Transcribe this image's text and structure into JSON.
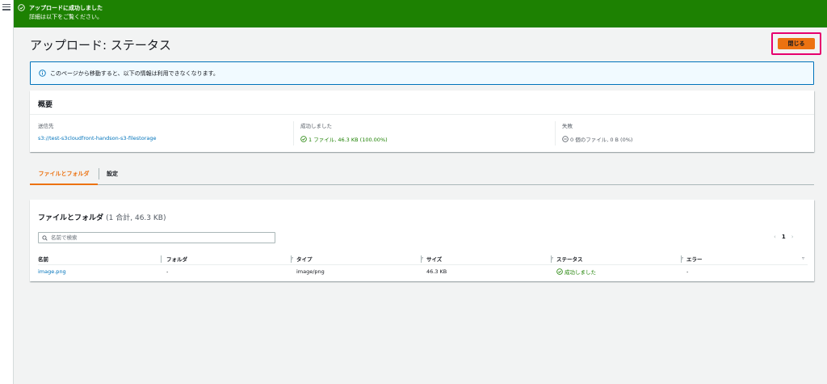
{
  "flash": {
    "title": "アップロードに成功しました",
    "message": "詳細は以下をご覧ください。",
    "color": "#1d8102"
  },
  "header": {
    "title": "アップロード: ステータス",
    "close_label": "閉じる"
  },
  "info": {
    "text": "このページから移動すると、以下の情報は利用できなくなります。"
  },
  "summary": {
    "title": "概要",
    "destination_label": "送信先",
    "destination_value": "s3://test-s3cloudfront-handson-s3-filestorage",
    "success_label": "成功しました",
    "success_value": "1 ファイル, 46.3 KB (100.00%)",
    "failed_label": "失敗",
    "failed_value": "0 個のファイル, 0 B (0%)"
  },
  "tabs": [
    {
      "label": "ファイルとフォルダ"
    },
    {
      "label": "設定"
    }
  ],
  "files": {
    "title": "ファイルとフォルダ",
    "count": "(1 合計, 46.3 KB)",
    "search_placeholder": "名前で検索",
    "page": "1",
    "columns": [
      "名前",
      "フォルダ",
      "タイプ",
      "サイズ",
      "ステータス",
      "エラー"
    ],
    "rows": [
      {
        "name": "image.png",
        "folder": "-",
        "type": "image/png",
        "size": "46.3 KB",
        "status": "成功しました",
        "error": "-"
      }
    ]
  }
}
